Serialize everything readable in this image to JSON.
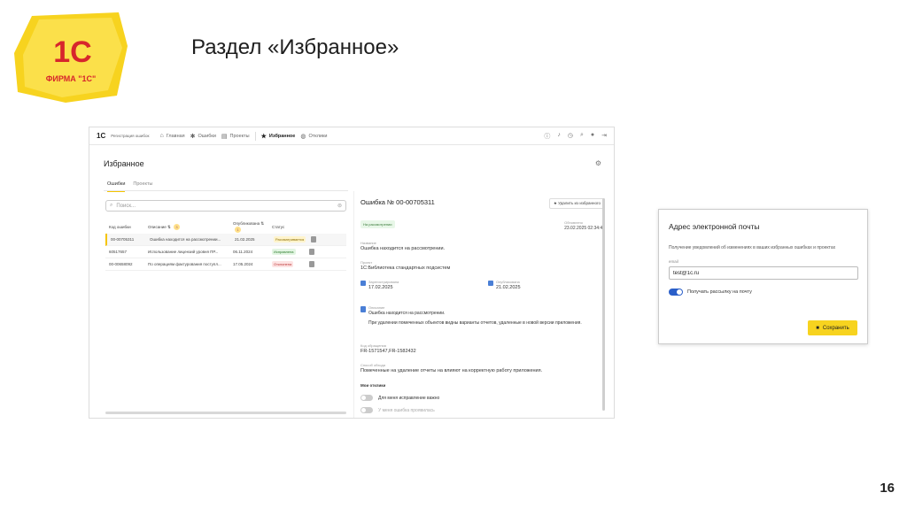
{
  "slide": {
    "title": "Раздел «Избранное»",
    "page_number": "16",
    "logo_text": "ФИРМА \"1С\""
  },
  "app": {
    "logo": "1С",
    "app_name": "Регистрация ошибок",
    "nav": [
      {
        "label": "Главная",
        "icon": "home-icon"
      },
      {
        "label": "Ошибки",
        "icon": "bug-icon"
      },
      {
        "label": "Проекты",
        "icon": "folder-icon"
      },
      {
        "label": "Избранное",
        "icon": "star-icon",
        "active": true
      },
      {
        "label": "Отклики",
        "icon": "response-icon"
      }
    ],
    "page_header": "Избранное",
    "tabs": [
      {
        "label": "Ошибки",
        "active": true
      },
      {
        "label": "Проекты",
        "active": false
      }
    ],
    "search": {
      "placeholder": "Поиск..."
    },
    "table": {
      "headers": {
        "code": "Код ошибки",
        "description": "Описание",
        "description_count": "3",
        "published": "Опубликована",
        "published_count": "1",
        "status": "Статус"
      },
      "rows": [
        {
          "code": "00-00705311",
          "description": "Ошибка находится на рассмотрении...",
          "date": "21.02.2025",
          "status": "Рассматривается",
          "status_color": "#fff4cc",
          "selected": true
        },
        {
          "code": "60517657",
          "description": "Использование лицензий уровня ПР...",
          "date": "06.11.2024",
          "status": "Исправлена",
          "status_color": "#e2f5e2",
          "selected": false
        },
        {
          "code": "00-00658092",
          "description": "По операциям фактурования поступл...",
          "date": "17.05.2024",
          "status": "Отклонена",
          "status_color": "#fde3e3",
          "selected": false
        }
      ]
    },
    "detail": {
      "title": "Ошибка № 00-00705311",
      "remove_button": "Удалить из избранного",
      "status_chip": "На рассмотрении",
      "updated_label": "Обновлено",
      "updated_value": "23.02.2025 02:34:46",
      "name_label": "Название",
      "name_value": "Ошибка находится на рассмотрении.",
      "project_label": "Проект",
      "project_value": "1С:Библиотека стандартных подсистем",
      "registered_label": "Зарегистрирована",
      "registered_value": "17.02.2025",
      "published_label": "Опубликована",
      "published_value": "21.02.2025",
      "description_label": "Описание",
      "description_line1": "Ошибка находится на рассмотрении.",
      "description_line2": "При удалении помеченных объектов видны варианты отчетов, удаленные в новой версии приложения.",
      "reg_code_label": "Код обращения",
      "reg_code_value": "FR-1571547,FR-1582432",
      "impact_label": "Способ обхода",
      "impact_value": "Помеченные на удаление отчеты на влияют на корректную работу приложения.",
      "my_responses": "Мои отклики",
      "toggle1": "Для меня исправление важно",
      "toggle2": "У меня ошибка проявилась"
    }
  },
  "email_dialog": {
    "title": "Адрес электронной почты",
    "description": "Получение уведомлений об изменениях в ваших избранных ошибках и проектах",
    "email_label": "email",
    "email_value": "test@1c.ru",
    "toggle_label": "Получать рассылку на почту",
    "save_button": "Сохранить"
  },
  "colors": {
    "brand_yellow": "#f7d31f",
    "brand_red": "#d7262c",
    "accent_blue": "#2a5fc9"
  }
}
